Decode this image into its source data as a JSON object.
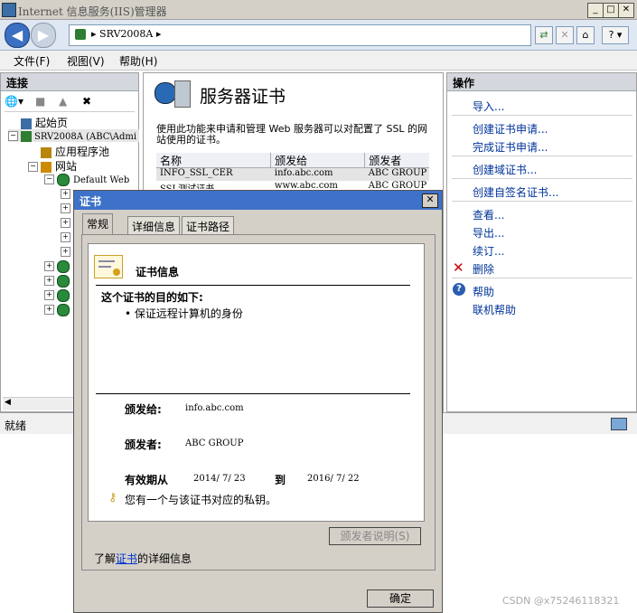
{
  "window": {
    "title": "Internet 信息服务(IIS)管理器"
  },
  "address": {
    "path": "SRV2008A"
  },
  "menu": [
    "文件(F)",
    "视图(V)",
    "帮助(H)"
  ],
  "left_pane": {
    "title": "连接",
    "tree": [
      {
        "label": "起始页"
      },
      {
        "label": "SRV2008A (ABC\\Admi"
      },
      {
        "label": "应用程序池"
      },
      {
        "label": "网站"
      },
      {
        "label": "Default Web"
      }
    ]
  },
  "center_pane": {
    "heading": "服务器证书",
    "description": "使用此功能来申请和管理 Web 服务器可以对配置了 SSL 的网站使用的证书。",
    "table": {
      "headers": [
        "名称",
        "颁发给",
        "颁发者"
      ],
      "rows": [
        [
          "INFO_SSL_CER",
          "info.abc.com",
          "ABC GROUP"
        ],
        [
          "SSL测试证书",
          "www.abc.com",
          "ABC GROUP"
        ]
      ]
    }
  },
  "right_pane": {
    "title": "操作",
    "actions": [
      "导入...",
      "创建证书申请...",
      "完成证书申请...",
      "创建域证书...",
      "创建自签名证书...",
      "查看...",
      "导出...",
      "续订...",
      "删除",
      "帮助",
      "联机帮助"
    ]
  },
  "status": {
    "text": "就绪"
  },
  "dialog": {
    "title": "证书",
    "tabs": [
      "常规",
      "详细信息",
      "证书路径"
    ],
    "cert_info_title": "证书信息",
    "purpose_heading": "这个证书的目的如下:",
    "purpose_item": "• 保证远程计算机的身份",
    "issued_to_label": "颁发给:",
    "issued_to": "info.abc.com",
    "issued_by_label": "颁发者:",
    "issued_by": "ABC GROUP",
    "valid_from_label": "有效期从",
    "valid_from": "2014/ 7/ 23",
    "valid_to_label": "到",
    "valid_to": "2016/ 7/ 22",
    "private_key_note": "您有一个与该证书对应的私钥。",
    "issuer_statement_button": "颁发者说明(S)",
    "learn_more_prefix": "了解",
    "learn_more_link": "证书",
    "learn_more_suffix": "的详细信息",
    "ok_button": "确定"
  },
  "watermark": "CSDN @x75246118321"
}
